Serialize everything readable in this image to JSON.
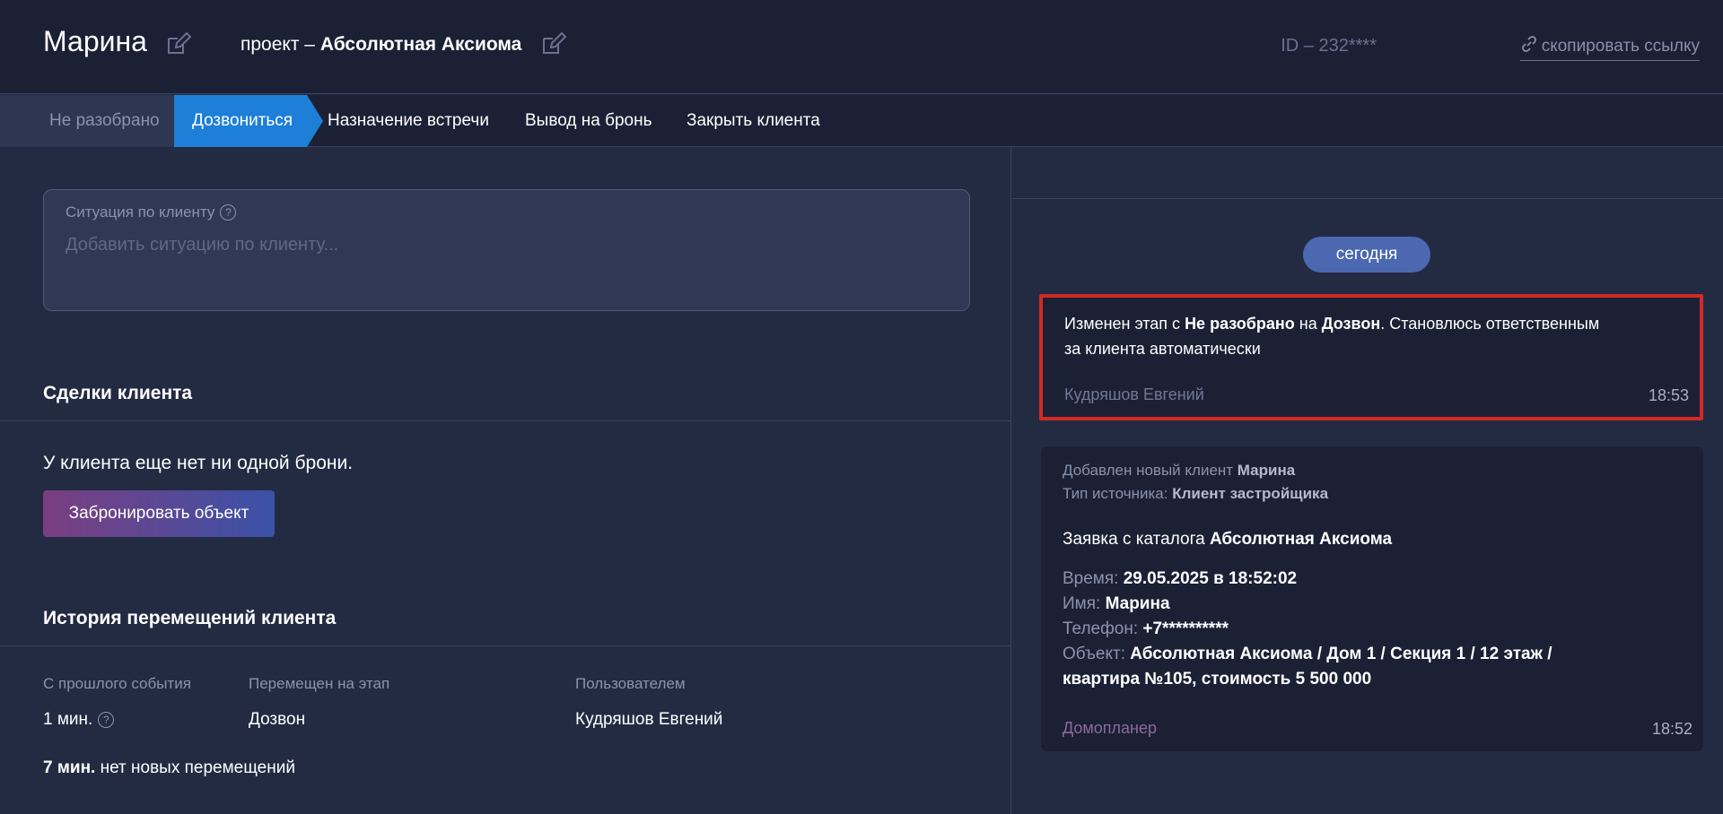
{
  "header": {
    "client_name": "Марина",
    "project_prefix": "проект – ",
    "project_name": "Абсолютная Аксиома",
    "client_id": "ID – 232****",
    "copy_link": "скопировать ссылку"
  },
  "stages": {
    "items": [
      {
        "label": "Не разобрано"
      },
      {
        "label": "Дозвониться"
      },
      {
        "label": "Назначение встречи"
      },
      {
        "label": "Вывод на бронь"
      },
      {
        "label": "Закрыть клиента"
      }
    ],
    "active": "Дозвониться"
  },
  "situation": {
    "label": "Ситуация по клиенту",
    "help": "?",
    "placeholder": "Добавить ситуацию по клиенту..."
  },
  "deals": {
    "title": "Сделки клиента",
    "empty_text": "У клиента еще нет ни одной брони.",
    "book_button": "Забронировать объект"
  },
  "history": {
    "title": "История перемещений клиента",
    "columns": [
      "С прошлого события",
      "Перемещен на этап",
      "Пользователем"
    ],
    "row": {
      "since": "1 мин.",
      "stage": "Дозвон",
      "user": "Кудряшов Евгений"
    },
    "summary_bold": "7 мин.",
    "summary_rest": " нет новых перемещений"
  },
  "timeline": {
    "date_pill": "сегодня",
    "event1": {
      "t1": "Изменен этап с ",
      "b1": "Не разобрано",
      "t2": " на ",
      "b2": "Дозвон",
      "t3": ". Становлюсь ответственным",
      "t4": "за клиента автоматически",
      "author": "Кудряшов Евгений",
      "time": "18:53"
    },
    "event2": {
      "added_label": "Добавлен новый клиент ",
      "added_name": "Марина",
      "source_label": "Тип источника: ",
      "source_value": "Клиент застройщика",
      "request_label": "Заявка с каталога ",
      "request_value": "Абсолютная Аксиома",
      "time_label": "Время: ",
      "time_value": "29.05.2025 в 18:52:02",
      "name_label": "Имя: ",
      "name_value": "Марина",
      "phone_label": "Телефон: ",
      "phone_value": "+7**********",
      "object_label": "Объект: ",
      "object_value_1": "Абсолютная Аксиома / Дом 1 / Секция 1 / 12 этаж /",
      "object_value_2": "квартира №105, стоимость 5 500 000",
      "author": "Домопланер",
      "time": "18:52"
    }
  },
  "colors": {
    "background": "#232b43",
    "header_bg": "#1b2035",
    "active_stage": "#1d7fd8",
    "highlight_border": "#d22a24",
    "date_pill": "#4b68b0"
  }
}
